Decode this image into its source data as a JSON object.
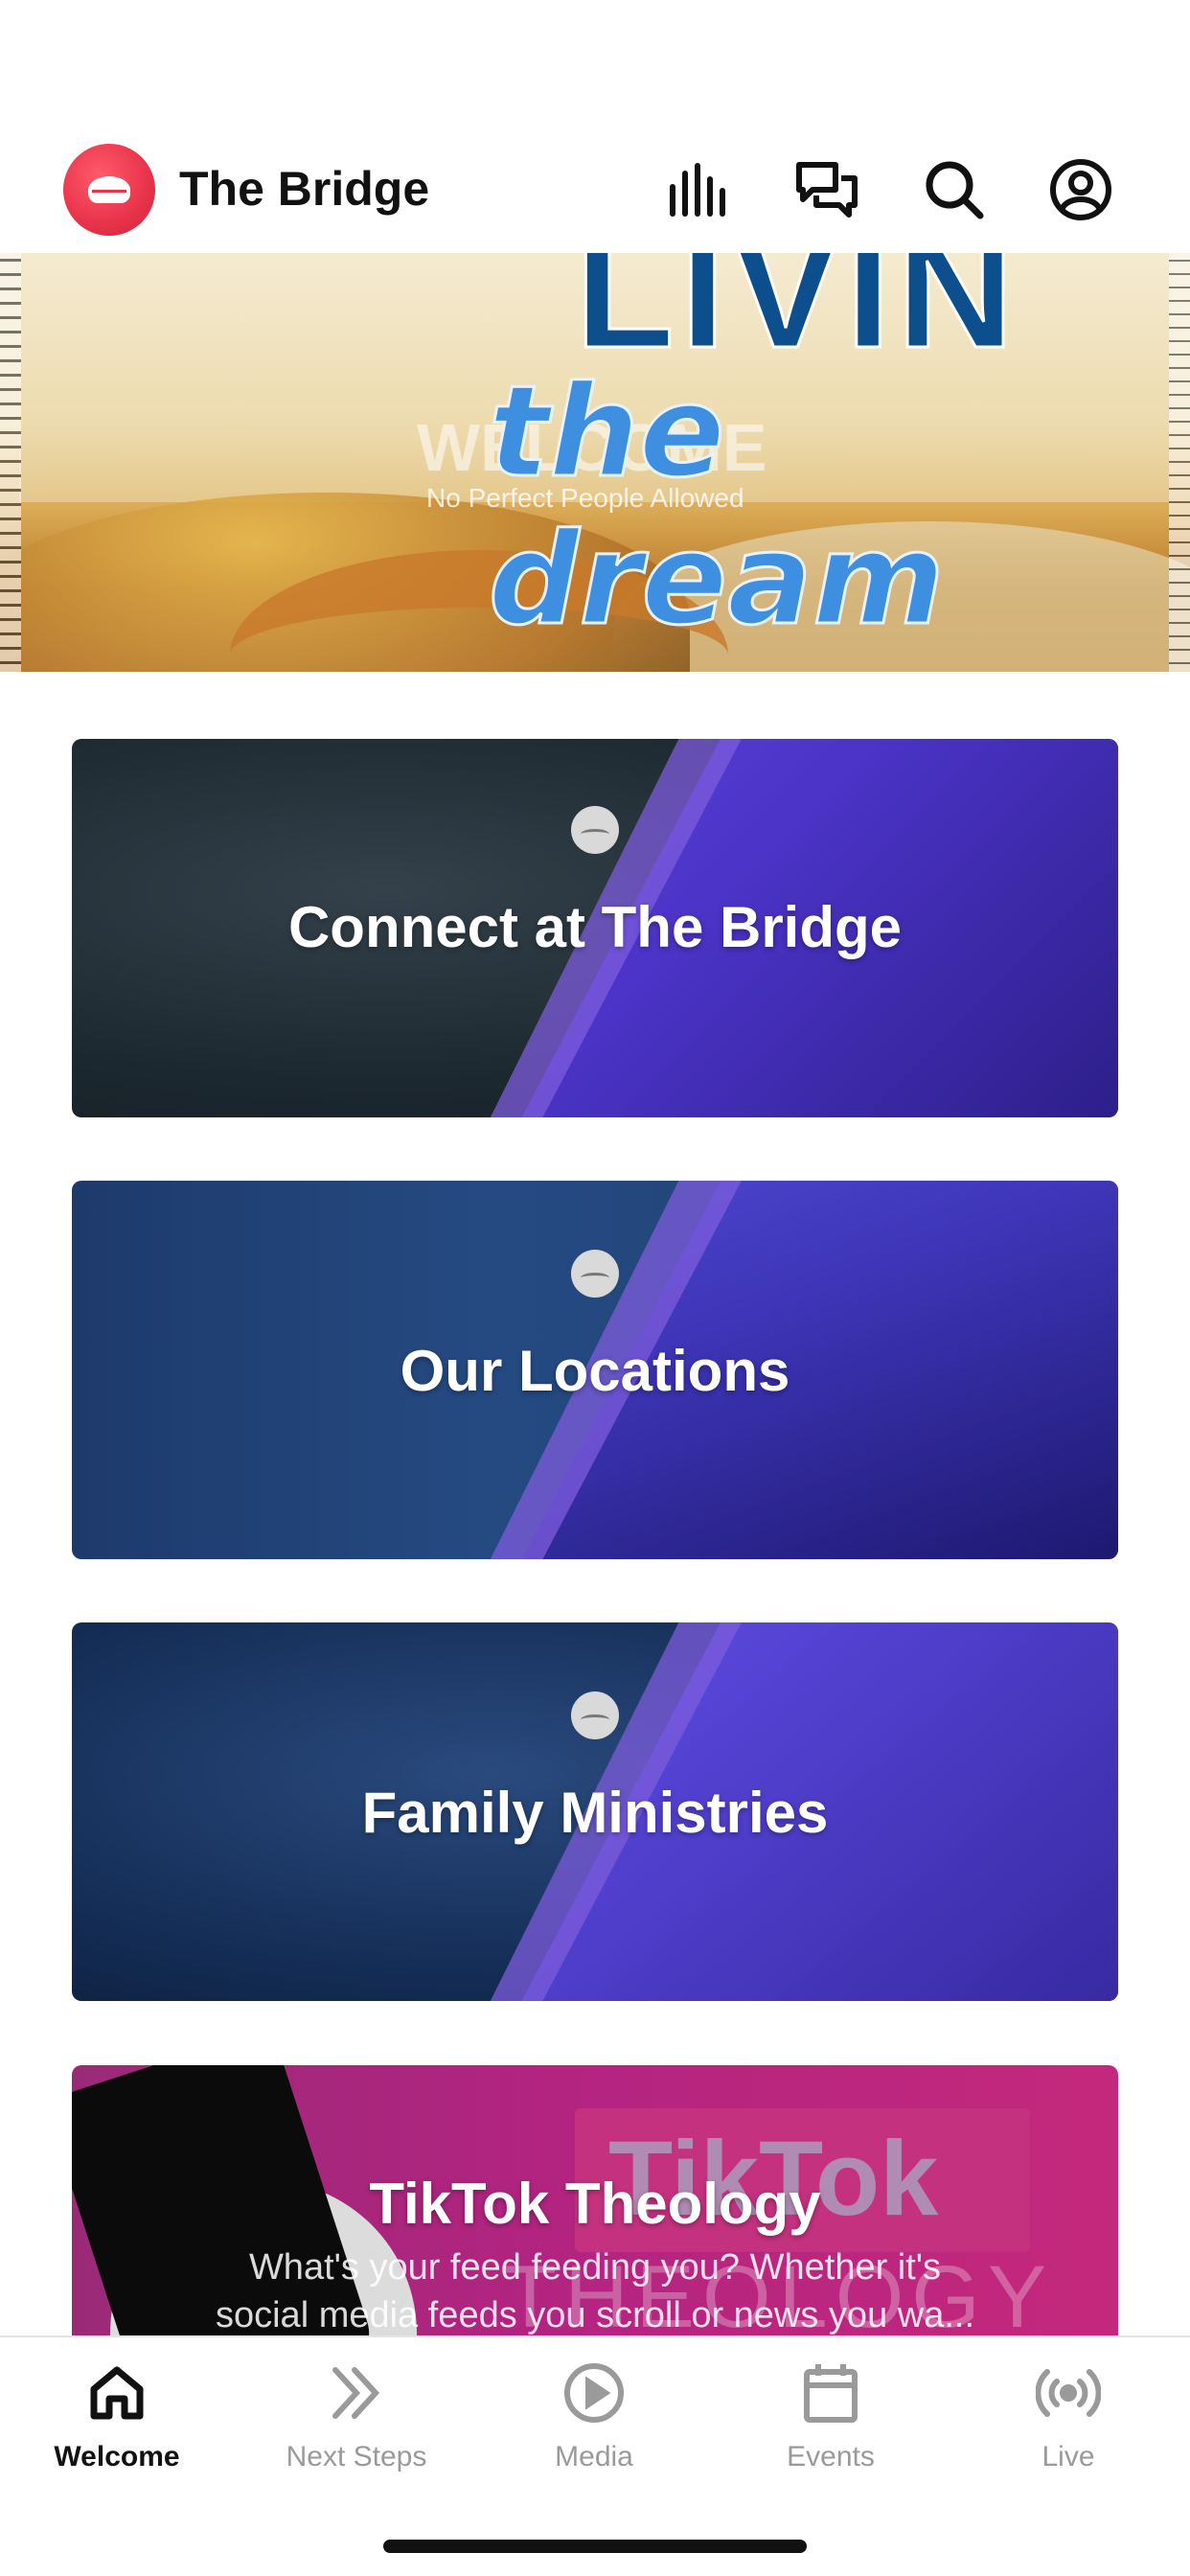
{
  "header": {
    "title": "The Bridge",
    "icons": [
      "stats-icon",
      "chat-icon",
      "search-icon",
      "profile-icon"
    ]
  },
  "hero": {
    "headline_top": "LIVIN",
    "headline_bottom": "the dream",
    "overlay_title": "WELCOME",
    "overlay_tagline": "No Perfect People Allowed"
  },
  "cards": [
    {
      "title": "Connect at The Bridge"
    },
    {
      "title": "Our Locations"
    },
    {
      "title": "Family Ministries"
    },
    {
      "title": "TikTok Theology",
      "description_line1": "What's your feed feeding you? Whether it's",
      "description_line2": "social media feeds you scroll or news you wa...",
      "art_text_top": "TikTok",
      "art_text_bottom": "THEOLOGY"
    }
  ],
  "tabbar": {
    "active": "Welcome",
    "tabs": [
      {
        "label": "Welcome",
        "icon": "home-icon"
      },
      {
        "label": "Next Steps",
        "icon": "double-chevron-icon"
      },
      {
        "label": "Media",
        "icon": "play-circle-icon"
      },
      {
        "label": "Events",
        "icon": "calendar-icon"
      },
      {
        "label": "Live",
        "icon": "broadcast-icon"
      }
    ]
  },
  "colors": {
    "brand_red": "#e8334a",
    "card_purple": "#5b3fd6",
    "tiktok_pink": "#c2287f",
    "active_tab": "#111111",
    "inactive_tab": "#9a9a9a"
  }
}
